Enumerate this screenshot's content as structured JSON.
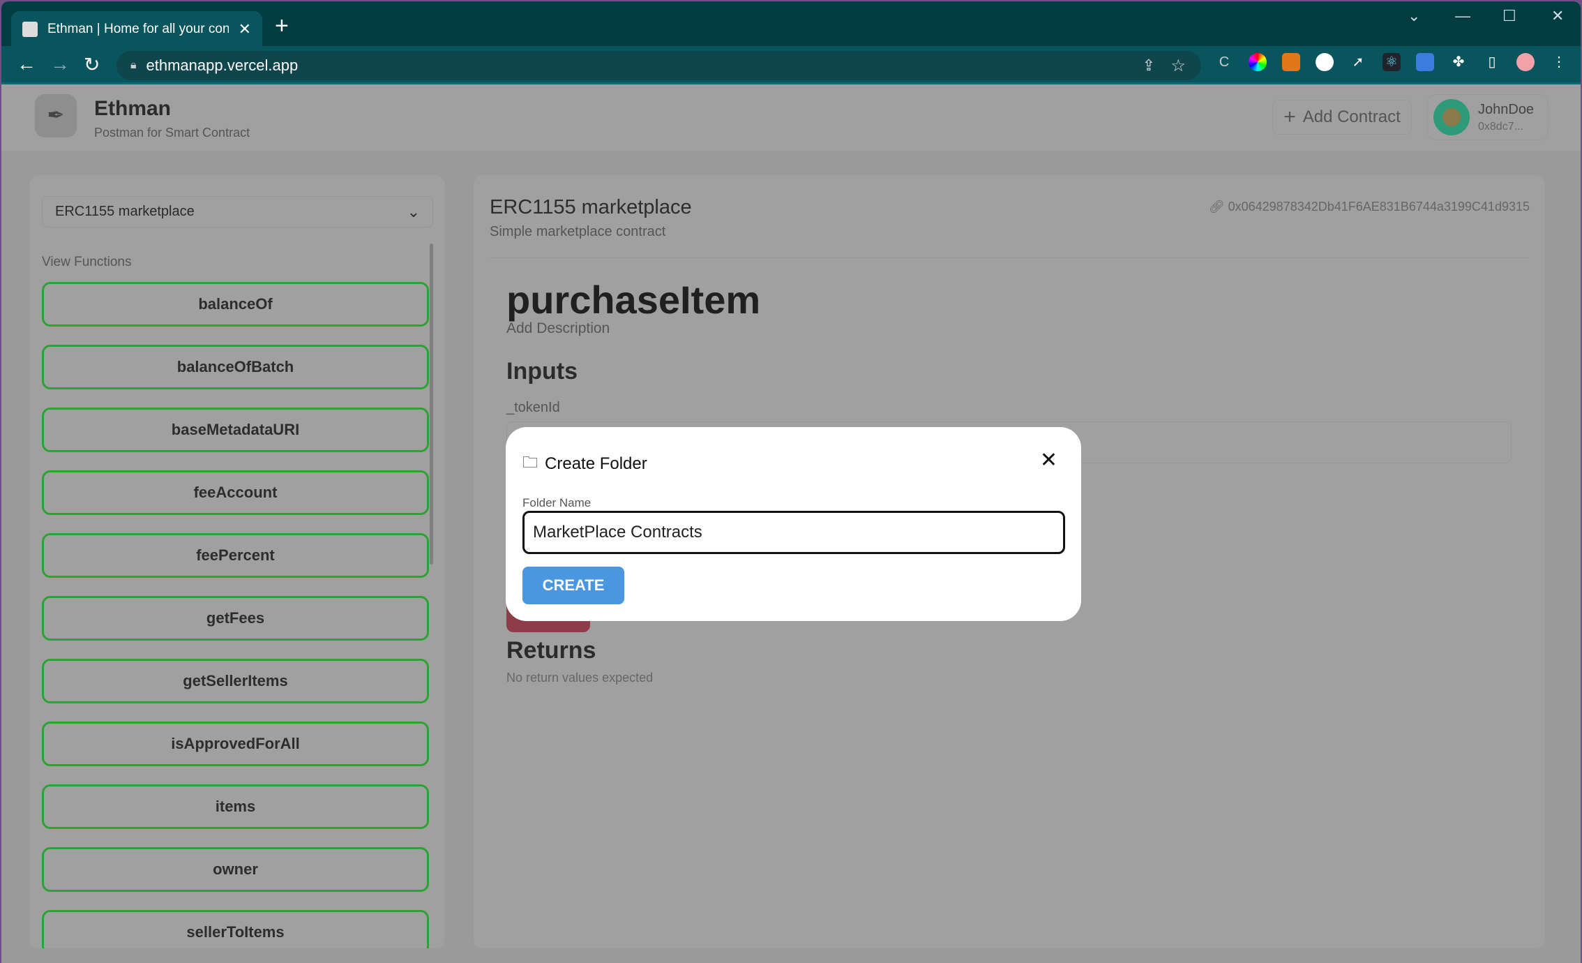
{
  "browser": {
    "tab_title": "Ethman | Home for all your contr",
    "url": "ethmanapp.vercel.app",
    "accent": "#023b42"
  },
  "header": {
    "app_name": "Ethman",
    "tagline": "Postman for Smart Contract",
    "add_contract": "Add Contract",
    "user_name": "JohnDoe",
    "user_address": "0x8dc7..."
  },
  "sidebar": {
    "selected_contract": "ERC1155 marketplace",
    "section_label": "View Functions",
    "functions": [
      "balanceOf",
      "balanceOfBatch",
      "baseMetadataURI",
      "feeAccount",
      "feePercent",
      "getFees",
      "getSellerItems",
      "isApprovedForAll",
      "items",
      "owner",
      "sellerToItems"
    ]
  },
  "main": {
    "contract_title": "ERC1155 marketplace",
    "contract_desc": "Simple marketplace contract",
    "contract_address": "0x06429878342Db41F6AE831B6744a3199C41d9315",
    "function_name": "purchaseItem",
    "add_description": "Add Description",
    "inputs_heading": "Inputs",
    "input_label": "_tokenId",
    "returns_heading": "Returns",
    "returns_text": "No return values expected"
  },
  "modal": {
    "title": "Create Folder",
    "field_label": "Folder Name",
    "field_value": "MarketPlace Contracts",
    "create_button": "CREATE",
    "button_color": "#4a97e0"
  }
}
